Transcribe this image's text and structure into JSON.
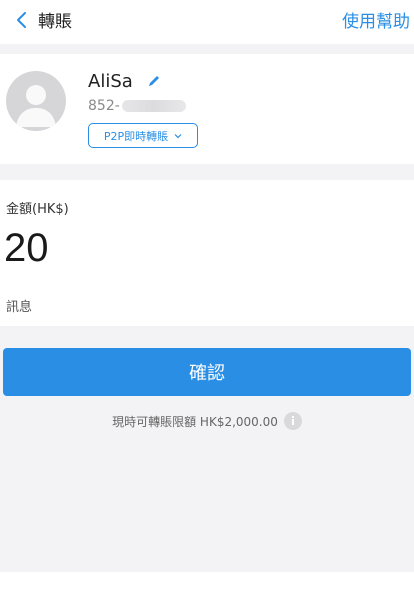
{
  "header": {
    "title": "轉賬",
    "help_label": "使用幫助"
  },
  "recipient": {
    "name": "AliSa",
    "phone_prefix": "852-",
    "transfer_type": "P2P即時轉賬"
  },
  "amount": {
    "label": "金額(HK$)",
    "value": "20"
  },
  "message": {
    "label": "訊息"
  },
  "confirm": {
    "label": "確認"
  },
  "limit": {
    "text": "現時可轉賬限額 HK$2,000.00"
  },
  "icons": {
    "back": "chevron-left-icon",
    "edit": "pencil-icon",
    "dropdown": "chevron-down-icon",
    "info": "info-icon",
    "avatar": "user-silhouette-icon"
  },
  "colors": {
    "accent": "#2a8fe4",
    "background": "#f3f3f5",
    "card": "#ffffff"
  }
}
